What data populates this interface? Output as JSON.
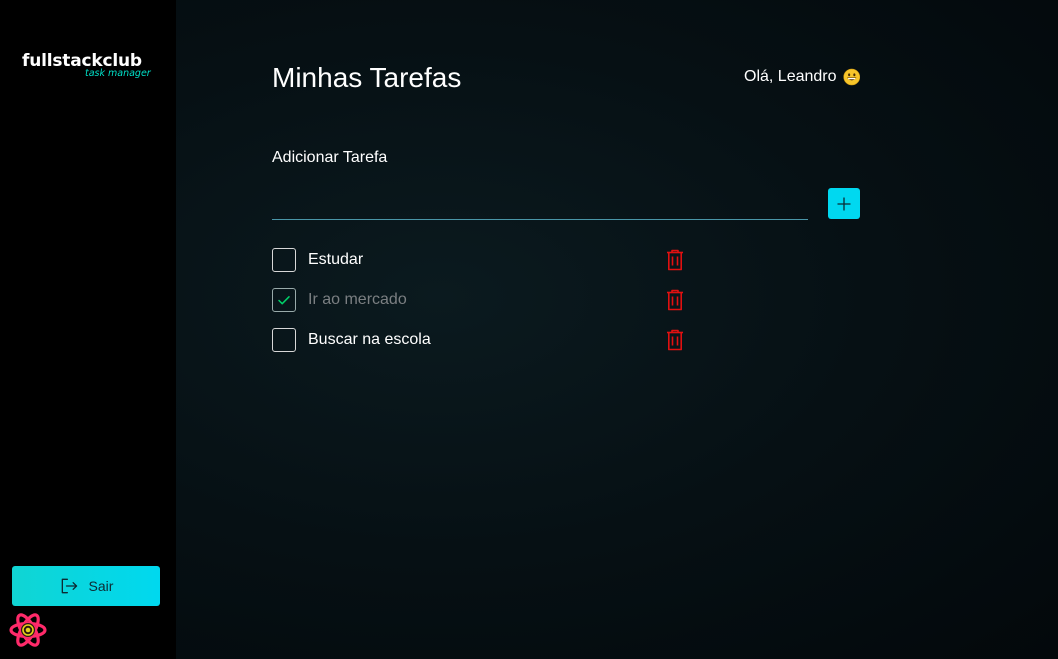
{
  "sidebar": {
    "logo_main": "fullstackclub",
    "logo_sub": "task manager",
    "signout_label": "Sair"
  },
  "header": {
    "title": "Minhas Tarefas",
    "greeting": "Olá, Leandro",
    "greeting_icon": "smile-emoji"
  },
  "add_task": {
    "label": "Adicionar Tarefa",
    "input_value": "",
    "button_icon": "plus-icon"
  },
  "tasks": [
    {
      "label": "Estudar",
      "completed": false
    },
    {
      "label": "Ir ao mercado",
      "completed": true
    },
    {
      "label": "Buscar na escola",
      "completed": false
    }
  ],
  "colors": {
    "accent": "#00d8f0",
    "delete": "#e01010",
    "sidebar_bg": "#000000",
    "main_bg": "#061014"
  }
}
